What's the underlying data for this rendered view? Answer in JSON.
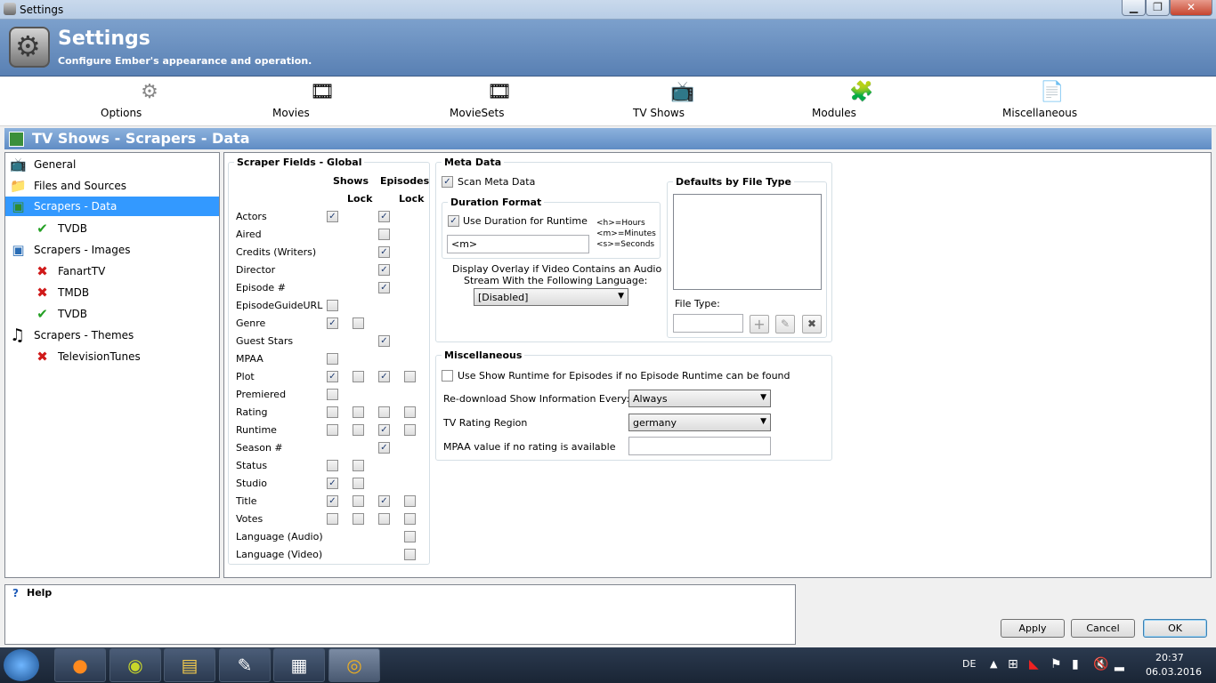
{
  "window": {
    "title": "Settings"
  },
  "header": {
    "title": "Settings",
    "subtitle": "Configure Ember's appearance and operation."
  },
  "toolbar": {
    "items": [
      {
        "label": "Options"
      },
      {
        "label": "Movies"
      },
      {
        "label": "MovieSets"
      },
      {
        "label": "TV Shows"
      },
      {
        "label": "Modules"
      },
      {
        "label": "Miscellaneous"
      }
    ]
  },
  "section": {
    "title": "TV Shows - Scrapers - Data"
  },
  "tree": {
    "items": [
      {
        "label": "General"
      },
      {
        "label": "Files and Sources"
      },
      {
        "label": "Scrapers - Data"
      },
      {
        "label": "TVDB"
      },
      {
        "label": "Scrapers - Images"
      },
      {
        "label": "FanartTV"
      },
      {
        "label": "TMDB"
      },
      {
        "label": "TVDB"
      },
      {
        "label": "Scrapers - Themes"
      },
      {
        "label": "TelevisionTunes"
      }
    ]
  },
  "scraper_fields": {
    "title": "Scraper Fields - Global",
    "col_shows": "Shows",
    "col_episodes": "Episodes",
    "col_lock": "Lock",
    "check_mark": "✓",
    "rows": [
      {
        "label": "Actors"
      },
      {
        "label": "Aired"
      },
      {
        "label": "Credits (Writers)"
      },
      {
        "label": "Director"
      },
      {
        "label": "Episode #"
      },
      {
        "label": "EpisodeGuideURL"
      },
      {
        "label": "Genre"
      },
      {
        "label": "Guest Stars"
      },
      {
        "label": "MPAA"
      },
      {
        "label": "Plot"
      },
      {
        "label": "Premiered"
      },
      {
        "label": "Rating"
      },
      {
        "label": "Runtime"
      },
      {
        "label": "Season #"
      },
      {
        "label": "Status"
      },
      {
        "label": "Studio"
      },
      {
        "label": "Title"
      },
      {
        "label": "Votes"
      },
      {
        "label": "Language (Audio)"
      },
      {
        "label": "Language (Video)"
      }
    ]
  },
  "meta_data": {
    "title": "Meta Data",
    "scan_label": "Scan Meta Data",
    "duration_title": "Duration Format",
    "use_duration_label": "Use Duration for Runtime",
    "duration_value": "<m>",
    "hint_h": "<h>=Hours",
    "hint_m": "<m>=Minutes",
    "hint_s": "<s>=Seconds",
    "overlay_text_1": "Display Overlay if Video Contains an Audio",
    "overlay_text_2": "Stream With the Following Language:",
    "overlay_value": "[Disabled]",
    "defaults_title": "Defaults by File Type",
    "file_type_label": "File Type:",
    "add_icon": "+",
    "edit_icon": "✎",
    "remove_icon": "✖"
  },
  "misc": {
    "title": "Miscellaneous",
    "runtime_label": "Use Show Runtime for Episodes if no Episode Runtime can be found",
    "redownload_label": "Re-download Show Information Every:",
    "redownload_value": "Always",
    "rating_region_label": "TV Rating Region",
    "rating_region_value": "germany",
    "mpaa_label": "MPAA value if no rating is available",
    "mpaa_value": ""
  },
  "help": {
    "title": "Help",
    "icon": "?"
  },
  "buttons": {
    "apply": "Apply",
    "cancel": "Cancel",
    "ok": "OK"
  },
  "taskbar": {
    "lang": "DE",
    "time": "20:37",
    "date": "06.03.2016"
  }
}
